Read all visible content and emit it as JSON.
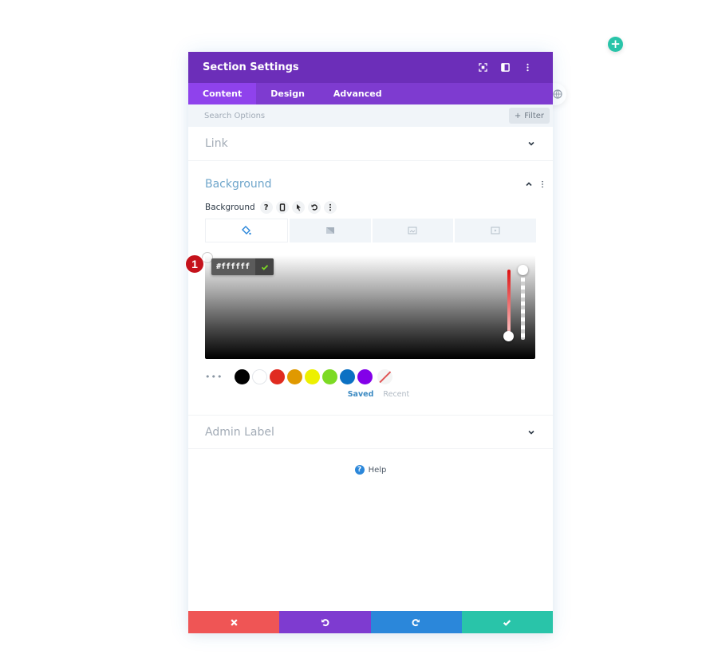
{
  "canvas": {
    "add_button_icon": "plus-icon",
    "add_button_label": "+",
    "globe_icon": "globe-icon"
  },
  "modal": {
    "title": "Section Settings",
    "header_icons": [
      "fullscreen-icon",
      "sidebar-toggle-icon",
      "more-options-icon"
    ],
    "tabs": [
      {
        "label": "Content",
        "active": true
      },
      {
        "label": "Design",
        "active": false
      },
      {
        "label": "Advanced",
        "active": false
      }
    ],
    "search": {
      "placeholder": "Search Options",
      "value": ""
    },
    "filter": {
      "icon": "plus-icon",
      "label": "Filter"
    },
    "sections": {
      "link": {
        "title": "Link",
        "expanded": false
      },
      "background": {
        "title": "Background",
        "expanded": true,
        "field_label": "Background",
        "field_icons": [
          "help-icon",
          "responsive-icon",
          "hover-pointer-icon",
          "reset-icon",
          "more-icon"
        ],
        "help_glyph": "?",
        "type_tabs": [
          {
            "name": "color",
            "icon": "paint-bucket-icon",
            "active": true
          },
          {
            "name": "gradient",
            "icon": "gradient-icon",
            "active": false
          },
          {
            "name": "image",
            "icon": "image-icon",
            "active": false
          },
          {
            "name": "video",
            "icon": "video-icon",
            "active": false
          }
        ],
        "color_picker": {
          "hex_value": "#ffffff",
          "confirm_icon": "check-icon",
          "hue_color": "#dd1111",
          "alpha_percent": 100
        },
        "annotation_badge": "1",
        "swatches_more": "•••",
        "swatches": [
          "#000000",
          "#ffffff",
          "#e02b20",
          "#e09900",
          "#edf000",
          "#7cda24",
          "#0c71c3",
          "#8300e9",
          "none"
        ],
        "palette_tabs": [
          {
            "label": "Saved",
            "active": true
          },
          {
            "label": "Recent",
            "active": false
          }
        ]
      },
      "admin_label": {
        "title": "Admin Label",
        "expanded": false
      }
    },
    "help": {
      "icon_glyph": "?",
      "label": "Help"
    },
    "footer": {
      "buttons": [
        {
          "name": "discard",
          "icon": "close-icon",
          "color": "#ef5555"
        },
        {
          "name": "undo",
          "icon": "undo-icon",
          "color": "#7e3bd0"
        },
        {
          "name": "redo",
          "icon": "redo-icon",
          "color": "#2b87da"
        },
        {
          "name": "save",
          "icon": "check-icon",
          "color": "#29c4a9"
        }
      ]
    }
  }
}
